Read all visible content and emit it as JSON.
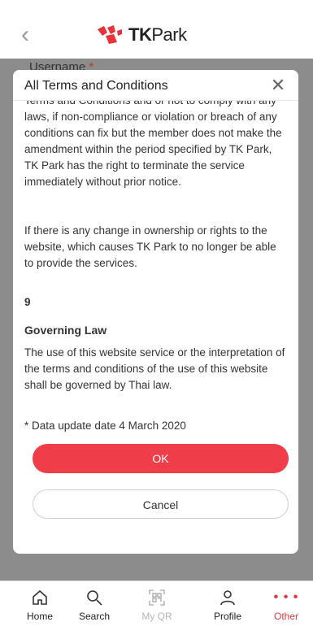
{
  "header": {
    "logo_tk": "TK",
    "logo_park": "Park"
  },
  "background": {
    "username_label": "Username",
    "required_mark": "*"
  },
  "modal": {
    "title": "All Terms and Conditions",
    "clipped_line": "Terms and Conditions and or not to comply with any",
    "paragraph1": "laws, if non-compliance or violation or breach of any conditions can fix but the member does not make the amendment within the period specified by TK Park, TK Park has the right to terminate the service immediately without prior notice.",
    "paragraph2": "If there is any change in ownership or rights to the website, which causes TK Park to no longer be able to provide the services.",
    "section_number": "9",
    "section_title": "Governing Law",
    "section_text": "The use of this website service or the interpretation of the terms and conditions of the use of this website shall be governed by Thai law.",
    "update_note": "* Data update date 4 March 2020",
    "ok_label": "OK",
    "cancel_label": "Cancel"
  },
  "tabbar": {
    "home": "Home",
    "search": "Search",
    "qr": "My QR",
    "profile": "Profile",
    "other": "Other"
  },
  "colors": {
    "accent": "#ef3e49",
    "overlay": "#8c8c8c"
  }
}
